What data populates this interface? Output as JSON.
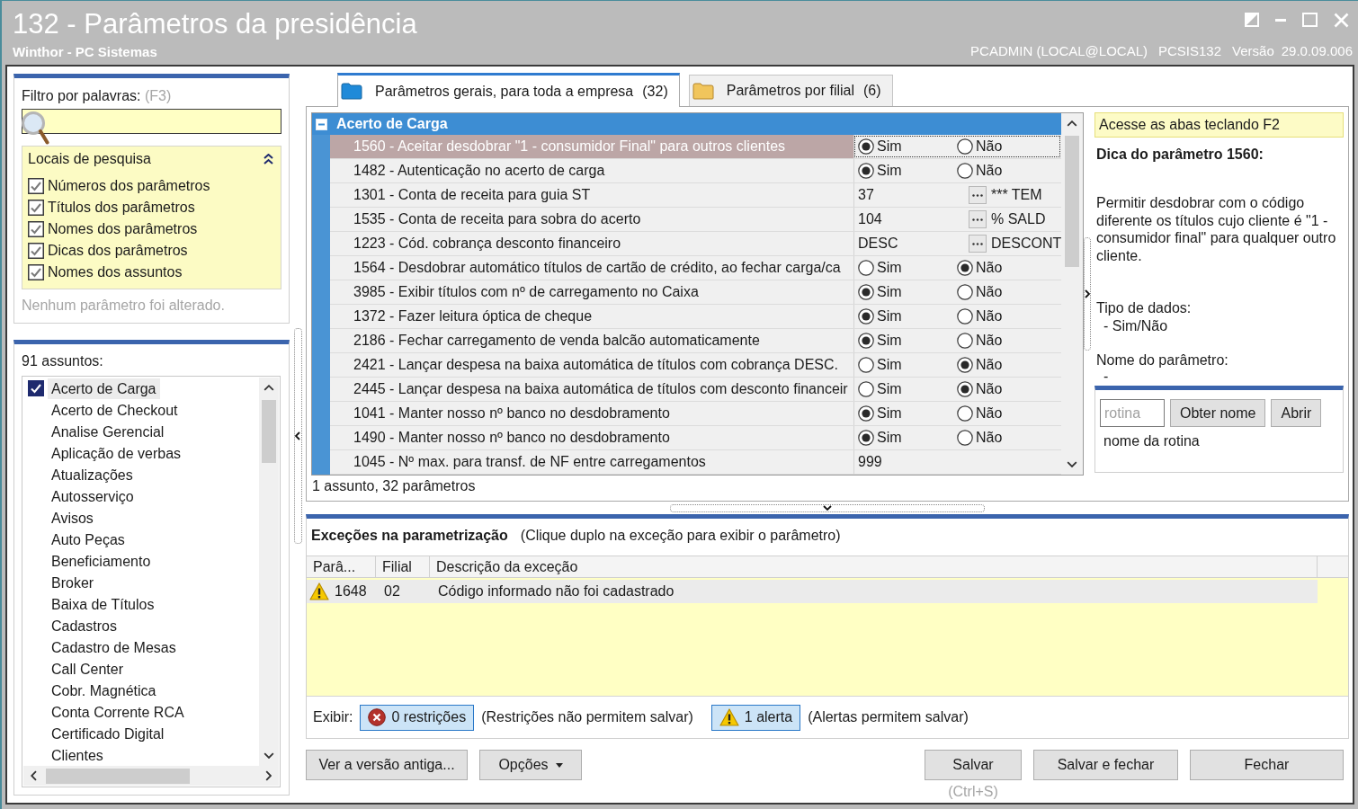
{
  "window": {
    "title": "132 - Parâmetros da presidência",
    "subtitle": "Winthor - PC Sistemas",
    "user": "PCADMIN (LOCAL@LOCAL)",
    "program": "PCSIS132",
    "version_label": "Versão",
    "version": "29.0.09.006"
  },
  "filter": {
    "label": "Filtro por palavras:",
    "shortcut": "(F3)",
    "locations": {
      "title": "Locais de pesquisa",
      "expanded": true,
      "options": [
        {
          "label": "Números dos parâmetros",
          "checked": true
        },
        {
          "label": "Títulos dos parâmetros",
          "checked": true
        },
        {
          "label": "Nomes dos parâmetros",
          "checked": true
        },
        {
          "label": "Dicas dos parâmetros",
          "checked": true
        },
        {
          "label": "Nomes dos assuntos",
          "checked": true
        }
      ]
    },
    "status": "Nenhum parâmetro foi alterado."
  },
  "subjects": {
    "count_label": "91 assuntos:",
    "items": [
      {
        "label": "Acerto de Carga",
        "checked": true,
        "selected": true
      },
      {
        "label": "Acerto de Checkout",
        "checked": false,
        "selected": false
      },
      {
        "label": "Analise Gerencial",
        "checked": false,
        "selected": false
      },
      {
        "label": "Aplicação de verbas",
        "checked": false,
        "selected": false
      },
      {
        "label": "Atualizações",
        "checked": false,
        "selected": false
      },
      {
        "label": "Autosserviço",
        "checked": false,
        "selected": false
      },
      {
        "label": "Avisos",
        "checked": false,
        "selected": false
      },
      {
        "label": "Auto Peças",
        "checked": false,
        "selected": false
      },
      {
        "label": "Beneficiamento",
        "checked": false,
        "selected": false
      },
      {
        "label": "Broker",
        "checked": false,
        "selected": false
      },
      {
        "label": "Baixa de Títulos",
        "checked": false,
        "selected": false
      },
      {
        "label": "Cadastros",
        "checked": false,
        "selected": false
      },
      {
        "label": "Cadastro de Mesas",
        "checked": false,
        "selected": false
      },
      {
        "label": "Call Center",
        "checked": false,
        "selected": false
      },
      {
        "label": "Cobr. Magnética",
        "checked": false,
        "selected": false
      },
      {
        "label": "Conta Corrente RCA",
        "checked": false,
        "selected": false
      },
      {
        "label": "Certificado Digital",
        "checked": false,
        "selected": false
      },
      {
        "label": "Clientes",
        "checked": false,
        "selected": false
      }
    ]
  },
  "tabs": [
    {
      "label": "Parâmetros gerais, para toda a empresa",
      "count": "(32)",
      "selected": true
    },
    {
      "label": "Parâmetros por filial",
      "count": "(6)",
      "selected": false
    }
  ],
  "grid": {
    "group": {
      "title": "Acerto de Carga",
      "expanded": true
    },
    "rows": [
      {
        "kind": "boolean",
        "label": "1560 - Aceitar desdobrar \"1 - consumidor Final\" para outros clientes",
        "selected": true,
        "options": [
          {
            "label": "Sim",
            "selected": true
          },
          {
            "label": "Não",
            "selected": false
          }
        ]
      },
      {
        "kind": "boolean",
        "label": "1482 - Autenticação no acerto de carga",
        "selected": false,
        "options": [
          {
            "label": "Sim",
            "selected": true
          },
          {
            "label": "Não",
            "selected": false
          }
        ]
      },
      {
        "kind": "lookup",
        "label": "1301 - Conta de receita para guia ST",
        "selected": false,
        "value": "37",
        "description": "*** TEM"
      },
      {
        "kind": "lookup",
        "label": "1535 - Conta de receita para sobra do acerto",
        "selected": false,
        "value": "104",
        "description": "% SALD"
      },
      {
        "kind": "lookup",
        "label": "1223 - Cód. cobrança desconto financeiro",
        "selected": false,
        "value": "DESC",
        "description": "DESCONT"
      },
      {
        "kind": "boolean",
        "label": "1564 - Desdobrar automático títulos de cartão de crédito, ao fechar carga/ca",
        "selected": false,
        "options": [
          {
            "label": "Sim",
            "selected": false
          },
          {
            "label": "Não",
            "selected": true
          }
        ]
      },
      {
        "kind": "boolean",
        "label": "3985 - Exibir títulos com nº de carregamento no Caixa",
        "selected": false,
        "options": [
          {
            "label": "Sim",
            "selected": true
          },
          {
            "label": "Não",
            "selected": false
          }
        ]
      },
      {
        "kind": "boolean",
        "label": "1372 - Fazer leitura óptica de cheque",
        "selected": false,
        "options": [
          {
            "label": "Sim",
            "selected": true
          },
          {
            "label": "Não",
            "selected": false
          }
        ]
      },
      {
        "kind": "boolean",
        "label": "2186 - Fechar carregamento de venda balcão automaticamente",
        "selected": false,
        "options": [
          {
            "label": "Sim",
            "selected": true
          },
          {
            "label": "Não",
            "selected": false
          }
        ]
      },
      {
        "kind": "boolean",
        "label": "2421 - Lançar despesa na baixa automática de títulos com cobrança DESC.",
        "selected": false,
        "options": [
          {
            "label": "Sim",
            "selected": false
          },
          {
            "label": "Não",
            "selected": true
          }
        ]
      },
      {
        "kind": "boolean",
        "label": "2445 - Lançar despesa na baixa automática de títulos com desconto financeir",
        "selected": false,
        "options": [
          {
            "label": "Sim",
            "selected": false
          },
          {
            "label": "Não",
            "selected": true
          }
        ]
      },
      {
        "kind": "boolean",
        "label": "1041 - Manter nosso nº banco no desdobramento",
        "selected": false,
        "options": [
          {
            "label": "Sim",
            "selected": true
          },
          {
            "label": "Não",
            "selected": false
          }
        ]
      },
      {
        "kind": "boolean",
        "label": "1490 - Manter nosso nº banco no desdobramento",
        "selected": false,
        "options": [
          {
            "label": "Sim",
            "selected": true
          },
          {
            "label": "Não",
            "selected": false
          }
        ]
      },
      {
        "kind": "number",
        "label": "1045 - Nº max. para transf. de NF entre carregamentos",
        "selected": false,
        "value": "999"
      }
    ],
    "status": "1 assunto, 32 parâmetros"
  },
  "tips": {
    "hint": "Acesse as abas teclando F2",
    "title": "Dica do parâmetro 1560:",
    "description": "Permitir desdobrar com o código diferente os títulos cujo cliente é \"1 - consumidor final\" para qualquer outro cliente.",
    "data_type_label": "Tipo de dados:",
    "data_type": "- Sim/Não",
    "name_label": "Nome do parâmetro:",
    "name": "-",
    "routine": {
      "placeholder": "rotina",
      "buttons": [
        "Obter nome",
        "Abrir"
      ],
      "result": "nome da rotina"
    }
  },
  "exceptions": {
    "title": "Exceções na parametrização",
    "hint": "(Clique duplo na exceção para exibir o parâmetro)",
    "columns": [
      "Parâ...",
      "Filial",
      "Descrição da exceção"
    ],
    "rows": [
      {
        "kind": "alert",
        "selected": true,
        "cells": [
          "1648",
          "02",
          "Código informado não foi cadastrado"
        ]
      }
    ],
    "filters": {
      "label": "Exibir:",
      "items": [
        {
          "kind": "restriction",
          "label": "0 restrições",
          "note": "(Restrições não permitem salvar)",
          "selected": true
        },
        {
          "kind": "alert",
          "label": "1 alerta",
          "note": "(Alertas permitem salvar)",
          "selected": true
        }
      ]
    }
  },
  "footer": {
    "left_buttons": [
      {
        "kind": "plain",
        "label": "Ver a versão antiga..."
      },
      {
        "kind": "menu",
        "label": "Opções"
      }
    ],
    "right_buttons": [
      {
        "kind": "plain",
        "label": "Salvar",
        "shortcut": "(Ctrl+S)"
      },
      {
        "kind": "plain",
        "label": "Salvar e fechar"
      },
      {
        "kind": "plain",
        "label": "Fechar"
      }
    ]
  }
}
